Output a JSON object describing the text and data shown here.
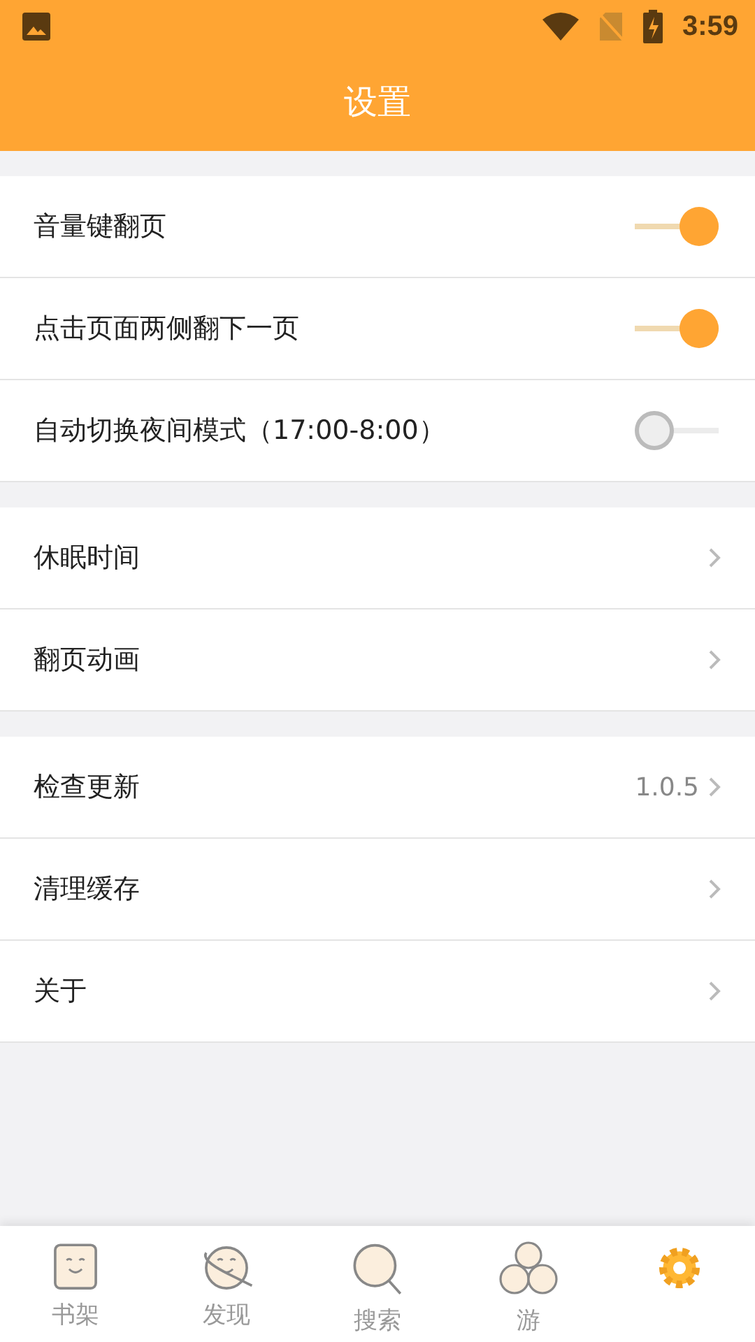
{
  "status_bar": {
    "time": "3:59"
  },
  "title": "设置",
  "groups": [
    {
      "rows": [
        {
          "kind": "toggle",
          "label": "音量键翻页",
          "on": true
        },
        {
          "kind": "toggle",
          "label": "点击页面两侧翻下一页",
          "on": true
        },
        {
          "kind": "toggle",
          "label": "自动切换夜间模式（17:00-8:00）",
          "on": false
        }
      ]
    },
    {
      "rows": [
        {
          "kind": "link",
          "label": "休眠时间"
        },
        {
          "kind": "link",
          "label": "翻页动画"
        }
      ]
    },
    {
      "rows": [
        {
          "kind": "link",
          "label": "检查更新",
          "value": "1.0.5"
        },
        {
          "kind": "link",
          "label": "清理缓存"
        },
        {
          "kind": "link",
          "label": "关于"
        }
      ]
    }
  ],
  "tabs": [
    {
      "kind": "shelf",
      "label": "书架"
    },
    {
      "kind": "discover",
      "label": "发现"
    },
    {
      "kind": "search",
      "label": "搜索"
    },
    {
      "kind": "games",
      "label": "游"
    },
    {
      "kind": "settings"
    }
  ]
}
